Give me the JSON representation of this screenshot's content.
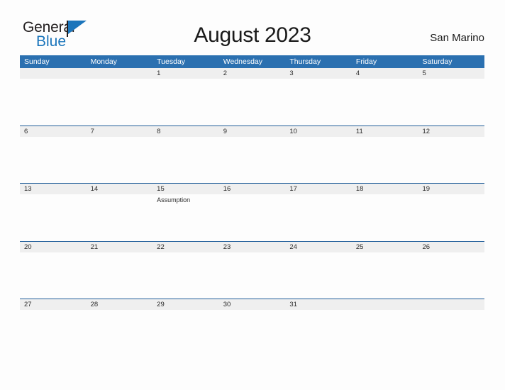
{
  "brand": {
    "name_part1": "General",
    "name_part2": "Blue",
    "flag_icon": "flag-triangle-icon"
  },
  "header": {
    "title": "August 2023",
    "location": "San Marino"
  },
  "calendar": {
    "weekdays": [
      "Sunday",
      "Monday",
      "Tuesday",
      "Wednesday",
      "Thursday",
      "Friday",
      "Saturday"
    ],
    "colors": {
      "header_blue": "#2b70b0",
      "row_divider": "#1f5d99",
      "date_band_gray": "#efefef",
      "brand_blue": "#1b75bb",
      "text_dark": "#2b2b2b"
    },
    "weeks": [
      [
        {
          "day": "",
          "events": []
        },
        {
          "day": "",
          "events": []
        },
        {
          "day": "1",
          "events": []
        },
        {
          "day": "2",
          "events": []
        },
        {
          "day": "3",
          "events": []
        },
        {
          "day": "4",
          "events": []
        },
        {
          "day": "5",
          "events": []
        }
      ],
      [
        {
          "day": "6",
          "events": []
        },
        {
          "day": "7",
          "events": []
        },
        {
          "day": "8",
          "events": []
        },
        {
          "day": "9",
          "events": []
        },
        {
          "day": "10",
          "events": []
        },
        {
          "day": "11",
          "events": []
        },
        {
          "day": "12",
          "events": []
        }
      ],
      [
        {
          "day": "13",
          "events": []
        },
        {
          "day": "14",
          "events": []
        },
        {
          "day": "15",
          "events": [
            "Assumption"
          ]
        },
        {
          "day": "16",
          "events": []
        },
        {
          "day": "17",
          "events": []
        },
        {
          "day": "18",
          "events": []
        },
        {
          "day": "19",
          "events": []
        }
      ],
      [
        {
          "day": "20",
          "events": []
        },
        {
          "day": "21",
          "events": []
        },
        {
          "day": "22",
          "events": []
        },
        {
          "day": "23",
          "events": []
        },
        {
          "day": "24",
          "events": []
        },
        {
          "day": "25",
          "events": []
        },
        {
          "day": "26",
          "events": []
        }
      ],
      [
        {
          "day": "27",
          "events": []
        },
        {
          "day": "28",
          "events": []
        },
        {
          "day": "29",
          "events": []
        },
        {
          "day": "30",
          "events": []
        },
        {
          "day": "31",
          "events": []
        },
        {
          "day": "",
          "events": []
        },
        {
          "day": "",
          "events": []
        }
      ]
    ]
  }
}
